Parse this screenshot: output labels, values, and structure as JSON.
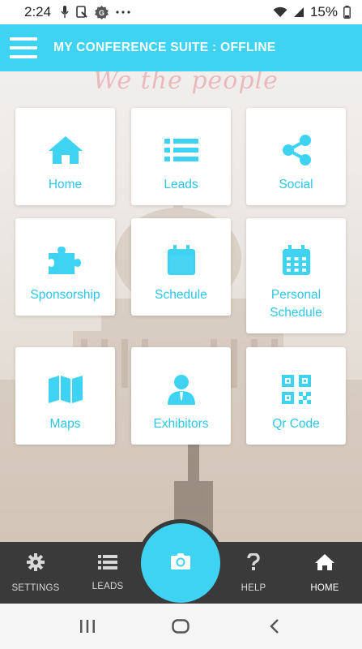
{
  "status_bar": {
    "time": "2:24",
    "battery_pct": "15%",
    "icons": [
      "mic-icon",
      "screenshot-icon",
      "app-g-icon",
      "more-dots-icon",
      "wifi-icon",
      "signal-icon",
      "battery-icon"
    ]
  },
  "header": {
    "title": "MY CONFERENCE SUITE : OFFLINE",
    "color": "#3ed3f2"
  },
  "background": {
    "watermark": "We the people"
  },
  "tiles": [
    {
      "label": "Home",
      "icon": "home-icon"
    },
    {
      "label": "Leads",
      "icon": "list-icon"
    },
    {
      "label": "Social",
      "icon": "share-icon"
    },
    {
      "label": "Sponsorship",
      "icon": "puzzle-icon"
    },
    {
      "label": "Schedule",
      "icon": "calendar-icon"
    },
    {
      "label": "Personal Schedule",
      "icon": "calendar-grid-icon"
    },
    {
      "label": "Maps",
      "icon": "map-icon"
    },
    {
      "label": "Exhibitors",
      "icon": "person-icon"
    },
    {
      "label": "Qr Code",
      "icon": "qr-code-icon"
    }
  ],
  "bottom_nav": {
    "items": [
      {
        "label": "SETTINGS",
        "icon": "gear-icon"
      },
      {
        "label": "LEADS",
        "icon": "list-icon"
      },
      {
        "label": "HELP",
        "icon": "question-icon"
      },
      {
        "label": "HOME",
        "icon": "home-icon"
      }
    ],
    "active": "HOME",
    "camera_icon": "camera-icon"
  },
  "system_nav": [
    "recents-icon",
    "home-circle-icon",
    "back-icon"
  ],
  "colors": {
    "accent": "#3ed3f2",
    "tile_text": "#2cc6e6",
    "nav_bg": "#3a3a3a"
  }
}
